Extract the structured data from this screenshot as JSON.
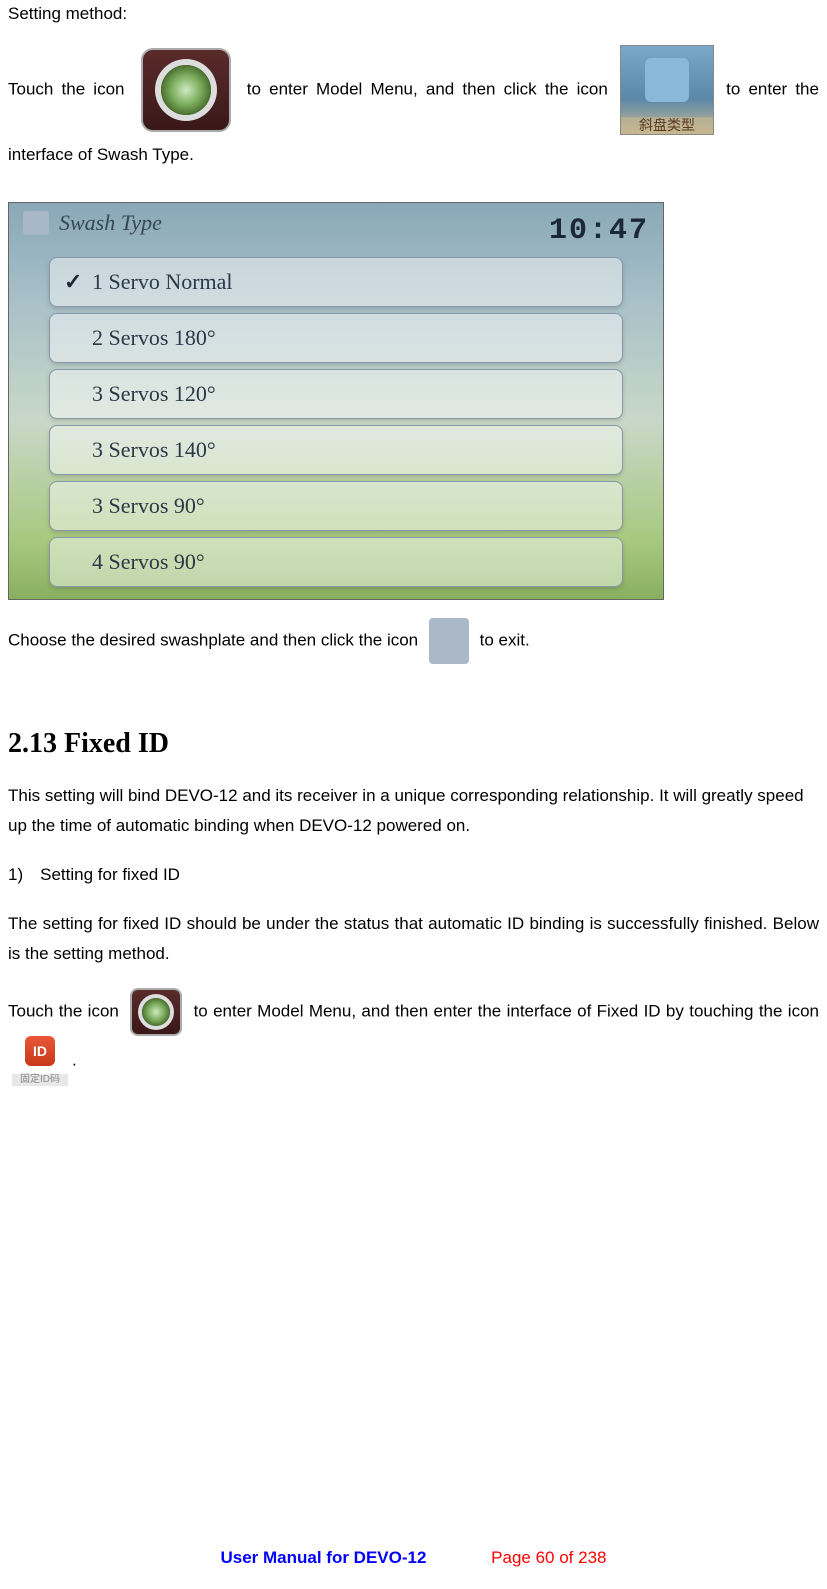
{
  "heading_setting_method": "Setting method:",
  "para1": {
    "t1": "Touch the icon ",
    "t2": " to enter Model Menu, and then click the icon ",
    "t3": "to enter the interface of Swash Type."
  },
  "swash_icon_caption": "斜盘类型",
  "screenshot": {
    "title": "Swash Type",
    "time": "10:47",
    "options": [
      {
        "label": "1 Servo Normal",
        "checked": true
      },
      {
        "label": "2 Servos 180°",
        "checked": false
      },
      {
        "label": "3 Servos 120°",
        "checked": false
      },
      {
        "label": "3 Servos 140°",
        "checked": false
      },
      {
        "label": "3 Servos 90°",
        "checked": false
      },
      {
        "label": "4 Servos 90°",
        "checked": false
      }
    ]
  },
  "para2": {
    "t1": "Choose the desired swashplate and then click the icon ",
    "t2": " to exit."
  },
  "section_heading": "2.13 Fixed ID",
  "para3": "This setting will bind DEVO-12 and its receiver in a unique corresponding relationship. It will greatly speed up the time of automatic binding when DEVO-12 powered on.",
  "subheading1": "1) Setting for fixed ID",
  "para4": "The setting for fixed ID should be under the status that automatic ID binding is successfully finished. Below is the setting method.",
  "para5": {
    "t1": "Touch the icon ",
    "t2": " to enter Model Menu, and then enter the interface of Fixed ID by touching the icon",
    "t3": "."
  },
  "id_icon_badge": "ID",
  "id_icon_caption": "固定ID码",
  "footer": {
    "title": "User Manual for DEVO-12",
    "page": "Page 60 of 238"
  }
}
